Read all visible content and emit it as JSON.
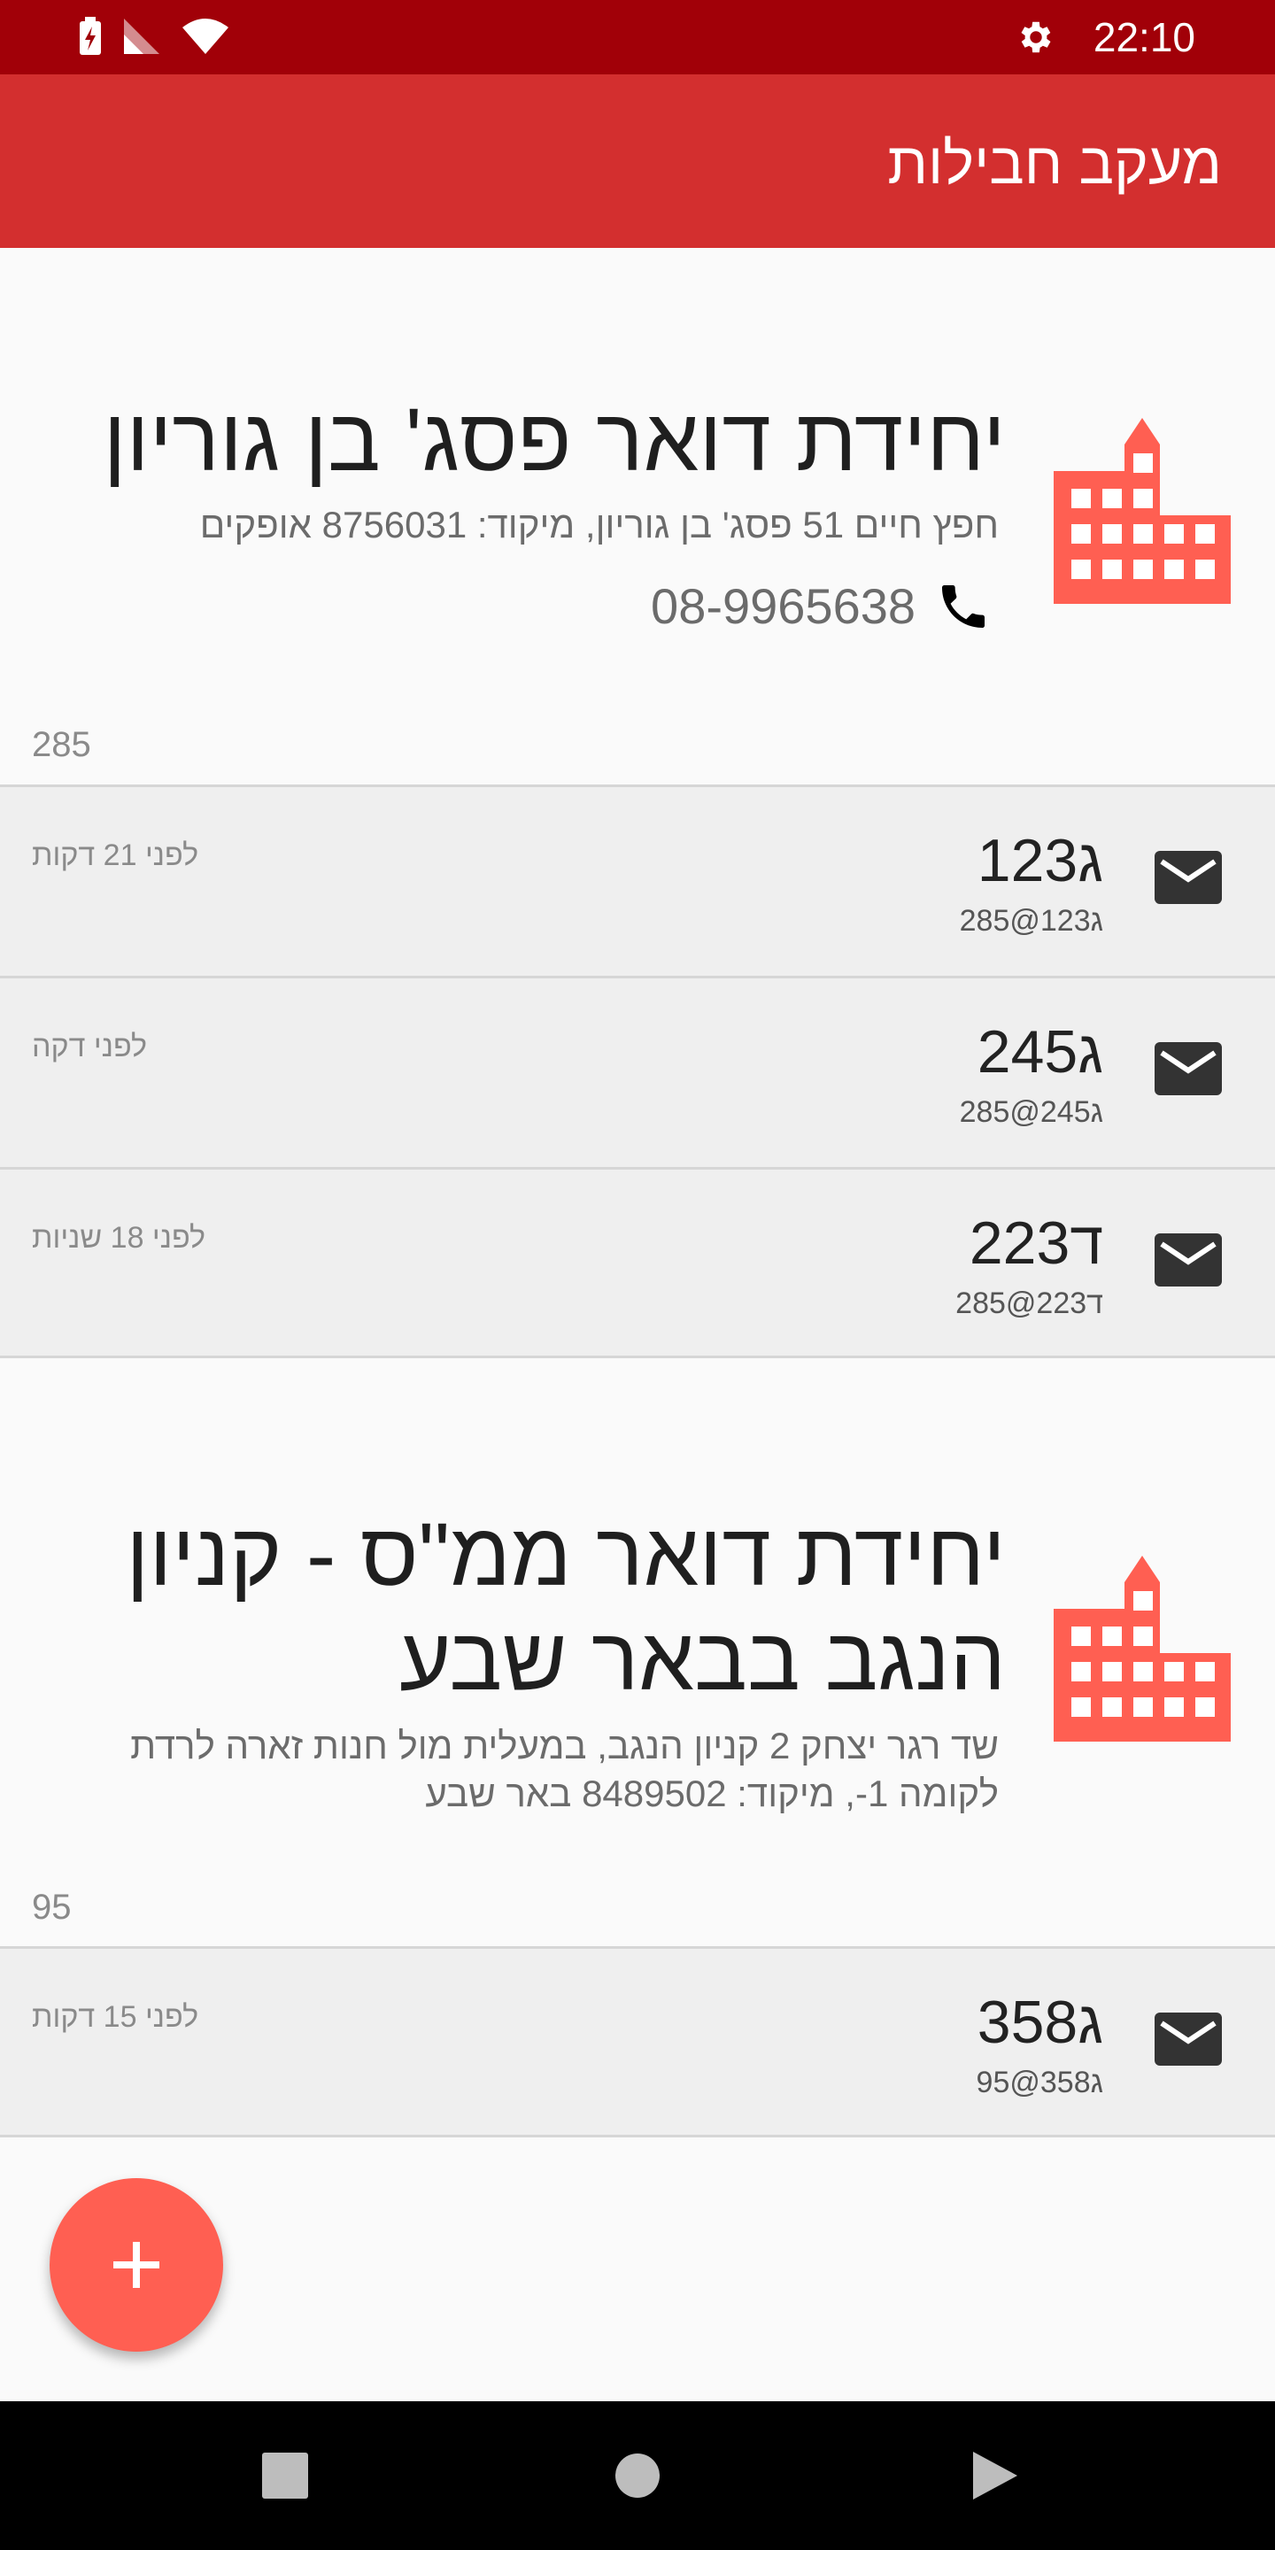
{
  "status_bar": {
    "time": "22:10",
    "icons": [
      "battery-charging-icon",
      "signal-icon",
      "wifi-icon",
      "gear-icon"
    ]
  },
  "app_bar": {
    "title": "מעקב חבילות"
  },
  "locations": [
    {
      "title": "יחידת דואר פסג' בן גוריון",
      "address": "חפץ חיים 51 פסג' בן גוריון, מיקוד: 8756031 אופקים",
      "phone": "08-9965638",
      "count": "285",
      "icon": "building-icon",
      "packages": [
        {
          "code": "ג123",
          "email": "ג123@285",
          "time": "לפני 21 דקות",
          "icon": "mail-icon"
        },
        {
          "code": "ג245",
          "email": "ג245@285",
          "time": "לפני דקה",
          "icon": "mail-icon"
        },
        {
          "code": "ד223",
          "email": "ד223@285",
          "time": "לפני 18 שניות",
          "icon": "mail-icon"
        }
      ]
    },
    {
      "title_lines": [
        "יחידת דואר ממ\"ס - קניון",
        "הנגב בבאר שבע"
      ],
      "address_lines": [
        "שד רגר יצחק 2 קניון הנגב, במעלית מול חנות זארה לרדת",
        "לקומה 1-, מיקוד: 8489502 באר שבע"
      ],
      "count": "95",
      "icon": "building-icon",
      "packages": [
        {
          "code": "ג358",
          "email": "ג358@95",
          "time": "לפני 15 דקות",
          "icon": "mail-icon"
        }
      ]
    }
  ],
  "fab": {
    "icon": "plus-icon"
  },
  "nav_bar": {
    "icons": [
      "recents-icon",
      "home-icon",
      "back-icon"
    ]
  },
  "colors": {
    "status_bar": "#a10008",
    "app_bar": "#d32f2f",
    "accent": "#ff5f52",
    "row_bg": "#efefef"
  }
}
